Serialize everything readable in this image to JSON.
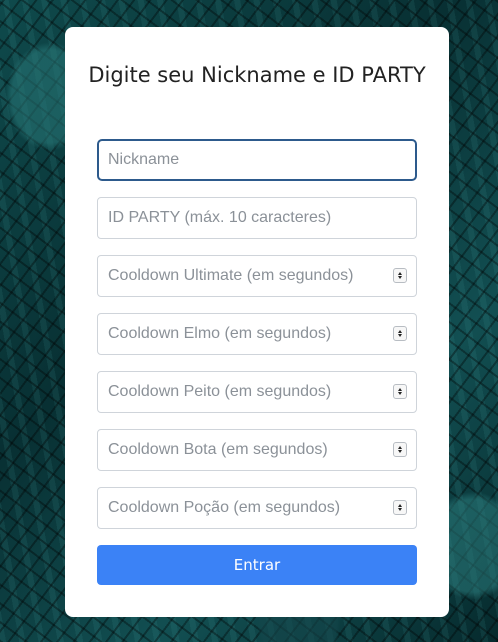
{
  "form": {
    "title": "Digite seu Nickname e ID PARTY",
    "nickname": {
      "placeholder": "Nickname",
      "value": ""
    },
    "party_id": {
      "placeholder": "ID PARTY (máx. 10 caracteres)",
      "value": ""
    },
    "cooldowns": [
      {
        "placeholder": "Cooldown Ultimate (em segundos)",
        "value": ""
      },
      {
        "placeholder": "Cooldown Elmo (em segundos)",
        "value": ""
      },
      {
        "placeholder": "Cooldown Peito (em segundos)",
        "value": ""
      },
      {
        "placeholder": "Cooldown Bota (em segundos)",
        "value": ""
      },
      {
        "placeholder": "Cooldown Poção (em segundos)",
        "value": ""
      }
    ],
    "submit_label": "Entrar"
  },
  "colors": {
    "button": "#3b82f6",
    "focus_border": "#2d5a8c",
    "background": "#0b3a3d"
  }
}
